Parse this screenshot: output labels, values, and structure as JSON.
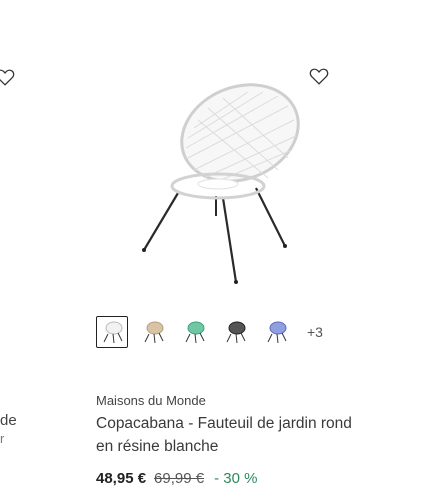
{
  "previous_card": {
    "title_fragment": "de",
    "title_fragment_2": "r"
  },
  "product": {
    "brand": "Maisons du Monde",
    "title": "Copacabana - Fauteuil de jardin rond en résine blanche",
    "price": "48,95 €",
    "old_price": "69,99 €",
    "discount": "- 30 %",
    "image_icon": "white-round-chair-image",
    "swatches": [
      {
        "name": "white",
        "color": "#f2f2f2",
        "selected": true
      },
      {
        "name": "beige",
        "color": "#d8c3a5",
        "selected": false
      },
      {
        "name": "green",
        "color": "#6fc7a3",
        "selected": false
      },
      {
        "name": "black",
        "color": "#444444",
        "selected": false
      },
      {
        "name": "blue",
        "color": "#8f9fe0",
        "selected": false
      }
    ],
    "more_swatches": "+3"
  },
  "colors": {
    "discount": "#2d8a5e",
    "text": "#333333"
  }
}
